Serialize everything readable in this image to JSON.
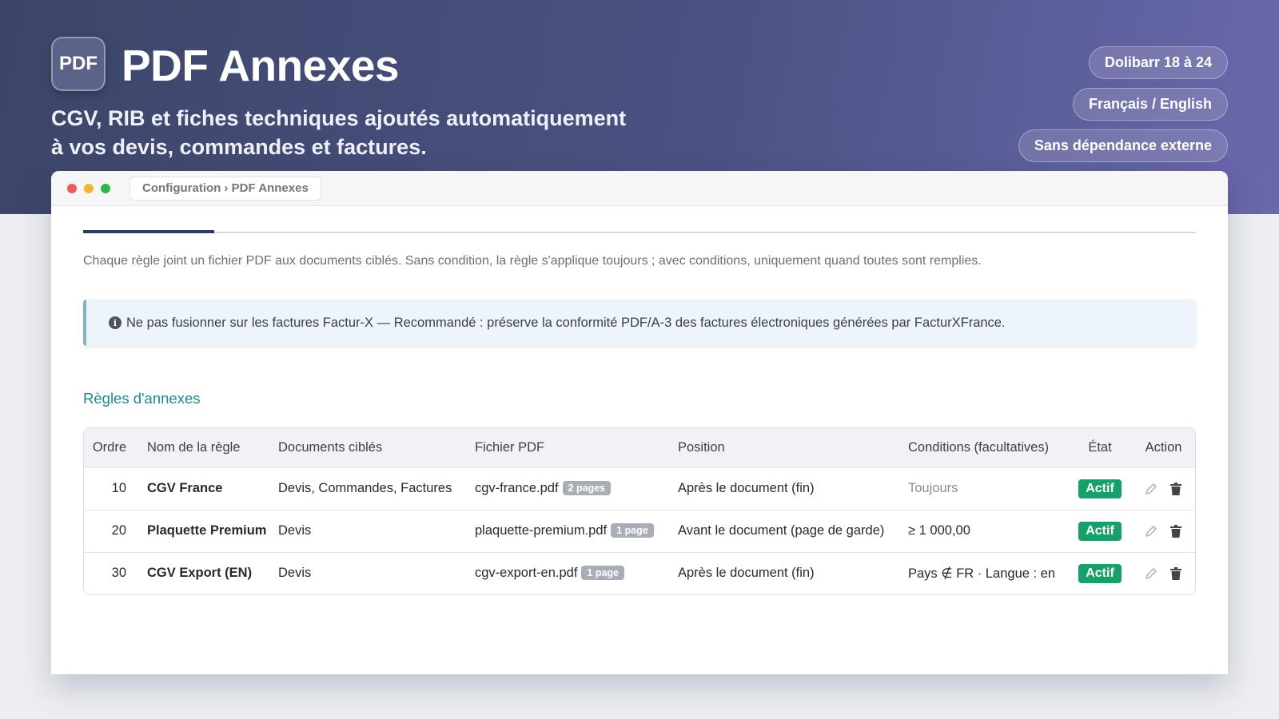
{
  "hero": {
    "logo_text": "PDF",
    "title": "PDF Annexes",
    "subtitle_line1": "CGV, RIB et fiches techniques ajoutés automatiquement",
    "subtitle_line2": "à vos devis, commandes et factures.",
    "pills": [
      "Dolibarr 18 à 24",
      "Français / English",
      "Sans dépendance externe"
    ]
  },
  "window": {
    "url": "Configuration › PDF Annexes"
  },
  "main": {
    "description": "Chaque règle joint un fichier PDF aux documents ciblés. Sans condition, la règle s'applique toujours ; avec conditions, uniquement quand toutes sont remplies.",
    "info_icon": "info-icon",
    "info_text": "Ne pas fusionner sur les factures Factur-X — Recommandé : préserve la conformité PDF/A-3 des factures électroniques générées par FacturXFrance.",
    "section_title": "Règles d'annexes"
  },
  "table": {
    "headers": {
      "order": "Ordre",
      "name": "Nom de la règle",
      "docs": "Documents ciblés",
      "file": "Fichier PDF",
      "position": "Position",
      "conditions": "Conditions (facultatives)",
      "state": "État",
      "action": "Action"
    },
    "rows": [
      {
        "order": "10",
        "name": "CGV France",
        "docs": "Devis, Commandes, Factures",
        "file": "cgv-france.pdf",
        "pages": "2 pages",
        "position": "Après le document (fin)",
        "conditions": "Toujours",
        "state": "Actif"
      },
      {
        "order": "20",
        "name": "Plaquette Premium",
        "docs": "Devis",
        "file": "plaquette-premium.pdf",
        "pages": "1 page",
        "position": "Avant le document (page de garde)",
        "conditions": "≥ 1 000,00",
        "state": "Actif"
      },
      {
        "order": "30",
        "name": "CGV Export (EN)",
        "docs": "Devis",
        "file": "cgv-export-en.pdf",
        "pages": "1 page",
        "position": "Après le document (fin)",
        "conditions": "Pays ∉ FR · Langue : en",
        "state": "Actif"
      }
    ]
  },
  "colors": {
    "hero_start": "#3c4568",
    "hero_end": "#6a68ad",
    "accent_teal": "#1a8a9a",
    "status_active": "#17a06a"
  }
}
